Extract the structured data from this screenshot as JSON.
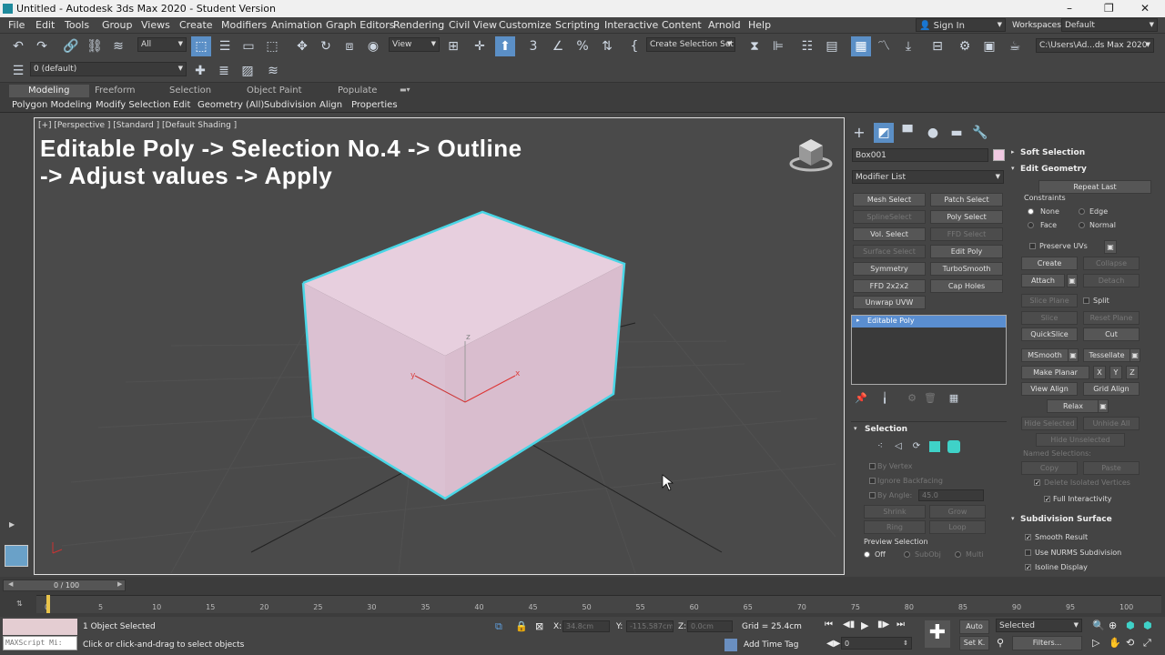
{
  "window": {
    "title": "Untitled - Autodesk 3ds Max 2020 - Student Version",
    "minimize": "–",
    "maximize": "❐",
    "close": "✕"
  },
  "menu": [
    "File",
    "Edit",
    "Tools",
    "Group",
    "Views",
    "Create",
    "Modifiers",
    "Animation",
    "Graph Editors",
    "Rendering",
    "Civil View",
    "Customize",
    "Scripting",
    "Interactive",
    "Content",
    "Arnold",
    "Help"
  ],
  "account": {
    "sign_in": "Sign In",
    "workspaces_label": "Workspaces:",
    "workspace": "Default"
  },
  "toolbar": {
    "filter": "All",
    "view": "View",
    "selection_set": "Create Selection Set",
    "path": "C:\\Users\\Ad...ds Max 2020",
    "layer": "0 (default)"
  },
  "ribbon_tabs": [
    "Modeling",
    "Freeform",
    "Selection",
    "Object Paint",
    "Populate"
  ],
  "ribbon_items": [
    "Polygon Modeling",
    "Modify Selection",
    "Edit",
    "Geometry (All)",
    "Subdivision",
    "Align",
    "Properties"
  ],
  "viewport": {
    "label": "[+] [Perspective ] [Standard ] [Default Shading ]",
    "caption_line1": "Editable Poly -> Selection No.4 -> Outline",
    "caption_line2": "-> Adjust values -> Apply",
    "box_color": "#e8d0df",
    "outline_color": "#49d6e6",
    "axis_x": "x",
    "axis_y": "y",
    "axis_z": "z"
  },
  "command_panel": {
    "object_name": "Box001",
    "modifier_list": "Modifier List",
    "modifier_buttons": [
      {
        "label": "Mesh Select",
        "dim": false
      },
      {
        "label": "Patch Select",
        "dim": false
      },
      {
        "label": "SplineSelect",
        "dim": true
      },
      {
        "label": "Poly Select",
        "dim": false
      },
      {
        "label": "Vol. Select",
        "dim": false
      },
      {
        "label": "FFD Select",
        "dim": true
      },
      {
        "label": "Surface Select",
        "dim": true
      },
      {
        "label": "Edit Poly",
        "dim": false
      },
      {
        "label": "Symmetry",
        "dim": false
      },
      {
        "label": "TurboSmooth",
        "dim": false
      },
      {
        "label": "FFD 2x2x2",
        "dim": false
      },
      {
        "label": "Cap Holes",
        "dim": false
      },
      {
        "label": "Unwrap UVW",
        "dim": false
      }
    ],
    "stack_item": "Editable Poly",
    "selection": {
      "title": "Selection",
      "by_vertex": "By Vertex",
      "ignore_backfacing": "Ignore Backfacing",
      "by_angle": "By Angle:",
      "angle_value": "45.0",
      "shrink": "Shrink",
      "grow": "Grow",
      "ring": "Ring",
      "loop": "Loop",
      "preview_title": "Preview Selection",
      "off": "Off",
      "subobj": "SubObj",
      "multi": "Multi"
    }
  },
  "rollouts": {
    "soft_selection": "Soft Selection",
    "edit_geometry": "Edit Geometry",
    "repeat_last": "Repeat Last",
    "constraints": "Constraints",
    "none": "None",
    "edge": "Edge",
    "face": "Face",
    "normal": "Normal",
    "preserve_uvs": "Preserve UVs",
    "create": "Create",
    "collapse": "Collapse",
    "attach": "Attach",
    "detach": "Detach",
    "slice_plane": "Slice Plane",
    "split": "Split",
    "slice": "Slice",
    "reset_plane": "Reset Plane",
    "quickslice": "QuickSlice",
    "cut": "Cut",
    "msmooth": "MSmooth",
    "tessellate": "Tessellate",
    "make_planar": "Make Planar",
    "x": "X",
    "y": "Y",
    "z": "Z",
    "view_align": "View Align",
    "grid_align": "Grid Align",
    "relax": "Relax",
    "hide_selected": "Hide Selected",
    "unhide_all": "Unhide All",
    "hide_unselected": "Hide Unselected",
    "named_selections": "Named Selections:",
    "copy": "Copy",
    "paste": "Paste",
    "delete_isolated": "Delete Isolated Vertices",
    "full_interactivity": "Full Interactivity",
    "subdivision_surface": "Subdivision Surface",
    "smooth_result": "Smooth Result",
    "use_nurms": "Use NURMS Subdivision",
    "isoline_display": "Isoline Display"
  },
  "timeline": {
    "frame": "0 / 100",
    "ticks": [
      "0",
      "5",
      "10",
      "15",
      "20",
      "25",
      "30",
      "35",
      "40",
      "45",
      "50",
      "55",
      "60",
      "65",
      "70",
      "75",
      "80",
      "85",
      "90",
      "95",
      "100"
    ]
  },
  "status": {
    "maxscript": "MAXScript Mi:",
    "selected": "1 Object Selected",
    "hint": "Click or click-and-drag to select objects",
    "x_label": "X:",
    "x_val": "34.8cm",
    "y_label": "Y:",
    "y_val": "-115.587cm",
    "z_label": "Z:",
    "z_val": "0.0cm",
    "grid": "Grid = 25.4cm",
    "add_time_tag": "Add Time Tag",
    "auto": "Auto",
    "set_key": "Set K.",
    "key_mode": "Selected",
    "filters": "Filters...",
    "frame_field": "0"
  }
}
